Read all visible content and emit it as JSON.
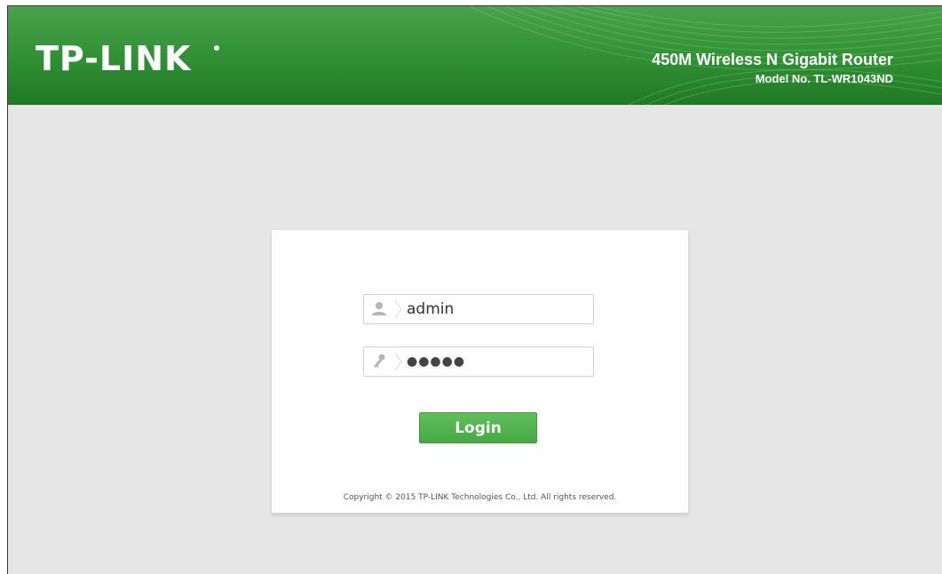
{
  "header": {
    "logo_text": "TP-LINK",
    "product_name": "450M Wireless N Gigabit Router",
    "model_no": "Model No. TL-WR1043ND"
  },
  "login": {
    "username_value": "admin",
    "username_icon": "user-icon",
    "password_value": "●●●●●",
    "password_icon": "key-icon",
    "button_label": "Login"
  },
  "footer": {
    "copyright": "Copyright © 2015 TP-LINK Technologies Co., Ltd. All rights reserved."
  },
  "colors": {
    "header_green": "#2f8f33",
    "button_green": "#4cae4a",
    "page_background": "#e6e6e6"
  }
}
